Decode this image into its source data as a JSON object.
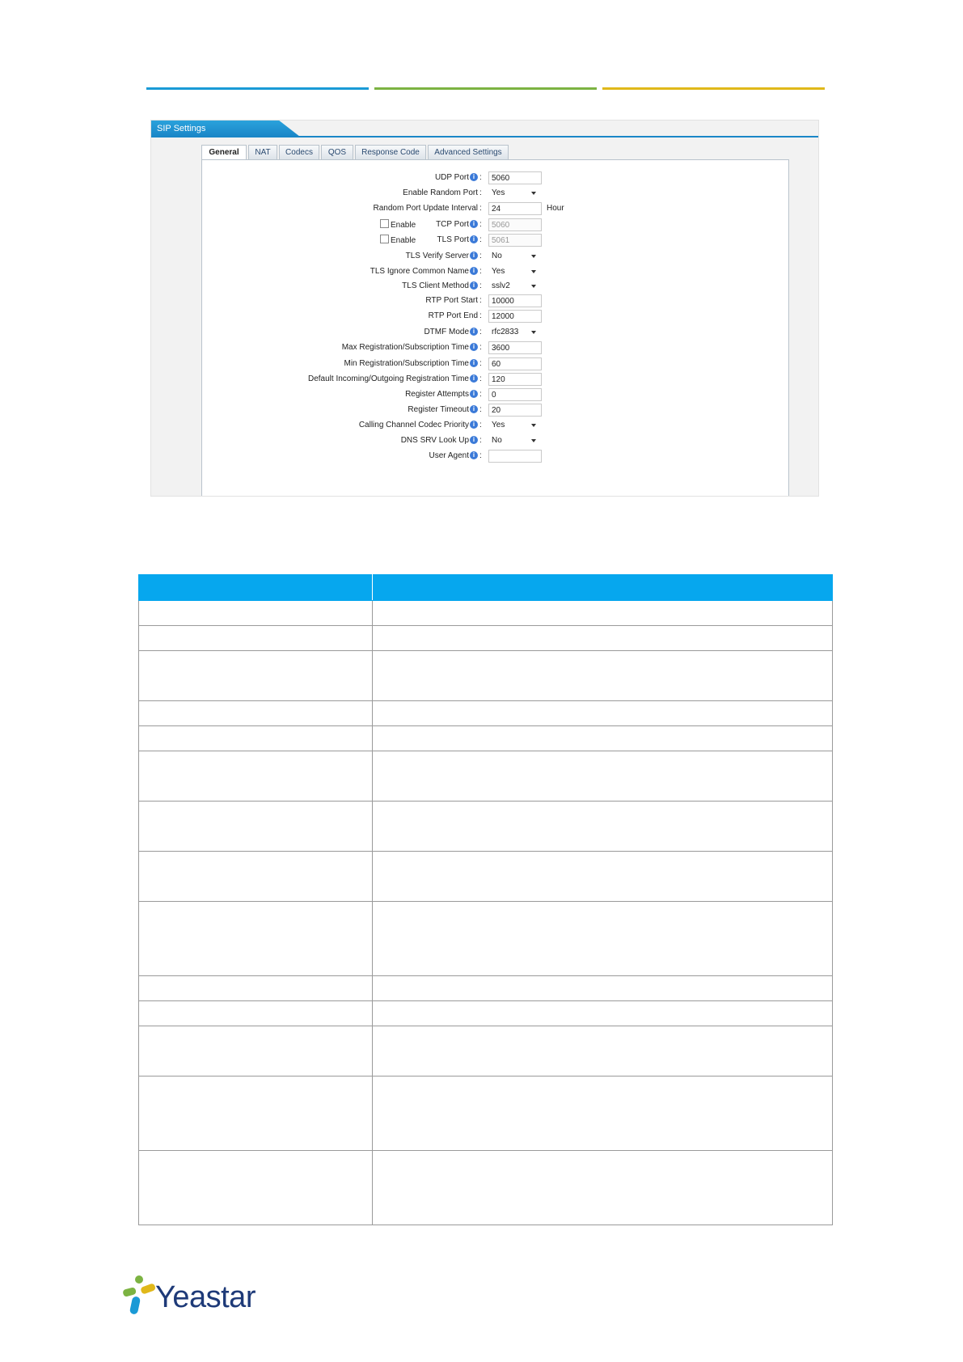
{
  "colors": {
    "header_line_1": "#1a9ad6",
    "header_line_2": "#7cb342",
    "header_line_3": "#e0b81a",
    "panel_title_bg": "#1a86c7",
    "table_header_bg": "#06a7ee",
    "logo_text": "#1e3a78"
  },
  "panel": {
    "title": "SIP Settings",
    "tabs": [
      {
        "label": "General",
        "active": true
      },
      {
        "label": "NAT",
        "active": false
      },
      {
        "label": "Codecs",
        "active": false
      },
      {
        "label": "QOS",
        "active": false
      },
      {
        "label": "Response Code",
        "active": false
      },
      {
        "label": "Advanced Settings",
        "active": false
      }
    ],
    "fields": [
      {
        "label": "UDP Port",
        "info": true,
        "type": "input",
        "value": "5060"
      },
      {
        "label": "Enable Random Port",
        "info": false,
        "type": "select",
        "value": "Yes"
      },
      {
        "label": "Random Port Update Interval",
        "info": false,
        "type": "input",
        "value": "24",
        "unit": "Hour"
      },
      {
        "label": "TCP Port",
        "info": true,
        "type": "input",
        "value": "5060",
        "disabled": true,
        "checkbox": "Enable"
      },
      {
        "label": "TLS Port",
        "info": true,
        "type": "input",
        "value": "5061",
        "disabled": true,
        "checkbox": "Enable"
      },
      {
        "label": "TLS Verify Server",
        "info": true,
        "type": "select",
        "value": "No"
      },
      {
        "label": "TLS Ignore Common Name",
        "info": true,
        "type": "select",
        "value": "Yes"
      },
      {
        "label": "TLS Client Method",
        "info": true,
        "type": "select",
        "value": "sslv2"
      },
      {
        "label": "RTP Port Start",
        "info": false,
        "type": "input",
        "value": "10000"
      },
      {
        "label": "RTP Port End",
        "info": false,
        "type": "input",
        "value": "12000"
      },
      {
        "label": "DTMF Mode",
        "info": true,
        "type": "select",
        "value": "rfc2833"
      },
      {
        "label": "Max Registration/Subscription Time",
        "info": true,
        "type": "input",
        "value": "3600"
      },
      {
        "label": "Min Registration/Subscription Time",
        "info": true,
        "type": "input",
        "value": "60"
      },
      {
        "label": "Default Incoming/Outgoing Registration Time",
        "info": true,
        "type": "input",
        "value": "120"
      },
      {
        "label": "Register Attempts",
        "info": true,
        "type": "input",
        "value": "0"
      },
      {
        "label": "Register Timeout",
        "info": true,
        "type": "input",
        "value": "20"
      },
      {
        "label": "Calling Channel Codec Priority",
        "info": true,
        "type": "select",
        "value": "Yes"
      },
      {
        "label": "DNS SRV Look Up",
        "info": true,
        "type": "select",
        "value": "No"
      },
      {
        "label": "User Agent",
        "info": true,
        "type": "input",
        "value": ""
      }
    ],
    "colon": ":",
    "info_glyph": "i"
  },
  "table": {
    "row_heights": [
      1,
      1,
      2,
      1,
      1,
      2,
      2,
      2,
      3,
      1,
      1,
      2,
      3,
      3
    ]
  },
  "logo": {
    "text": "Yeastar"
  }
}
